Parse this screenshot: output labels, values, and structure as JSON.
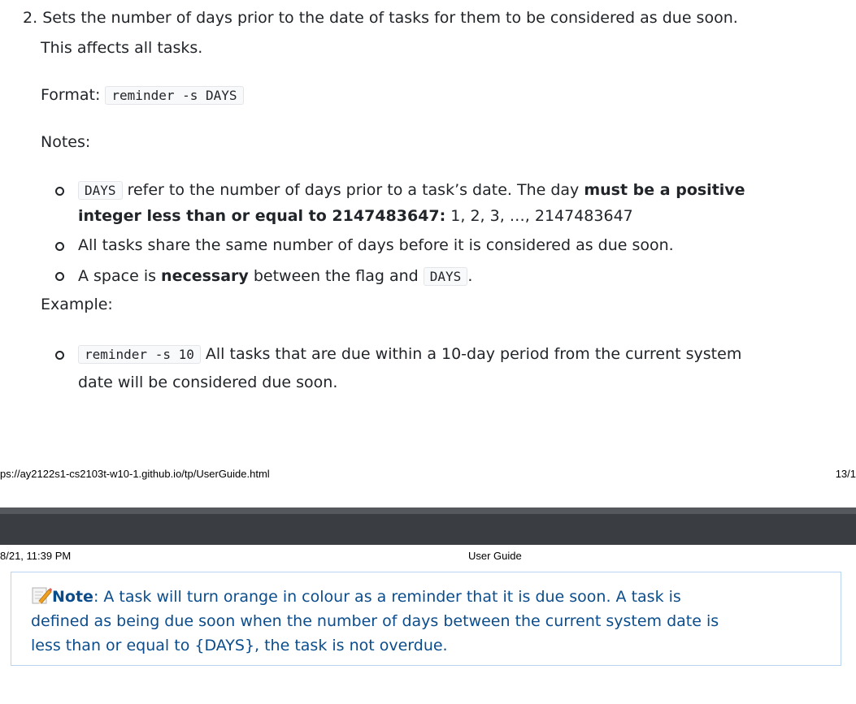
{
  "item2": {
    "number": "2.",
    "line1": "Sets the number of days prior to the date of tasks for them to be considered as due soon.",
    "line2": "This affects all tasks."
  },
  "format": {
    "label": "Format:",
    "code": "reminder -s DAYS"
  },
  "notes": {
    "label": "Notes:",
    "n1_code": "DAYS",
    "n1_text": " refer to the number of days prior to a task’s date. The day ",
    "n1_bold1": "must be a positive",
    "n1_bold2": "integer less than or equal to 2147483647:",
    "n1_tail": " 1, 2, 3, …, 2147483647",
    "n2": "All tasks share the same number of days before it is considered as due soon.",
    "n3_pre": "A space is ",
    "n3_bold": "necessary",
    "n3_mid": " between the flag and ",
    "n3_code": "DAYS",
    "n3_end": "."
  },
  "example": {
    "label": "Example:",
    "code": "reminder -s 10",
    "text1": " All tasks that are due within a 10-day period from the current system",
    "text2": "date will be considered due soon."
  },
  "footer": {
    "url": "ps://ay2122s1-cs2103t-w10-1.github.io/tp/UserGuide.html",
    "page": "13/1"
  },
  "header": {
    "datetime": "8/21, 11:39 PM",
    "title": "User Guide"
  },
  "note_box": {
    "icon": "pencil-memo-icon",
    "label": "Note",
    "line1": ": A task will turn orange in colour as a reminder that it is due soon. A task is",
    "line2": "defined as being due soon when the number of days between the current system date is",
    "line3": "less than or equal to {DAYS}, the task is not overdue."
  }
}
